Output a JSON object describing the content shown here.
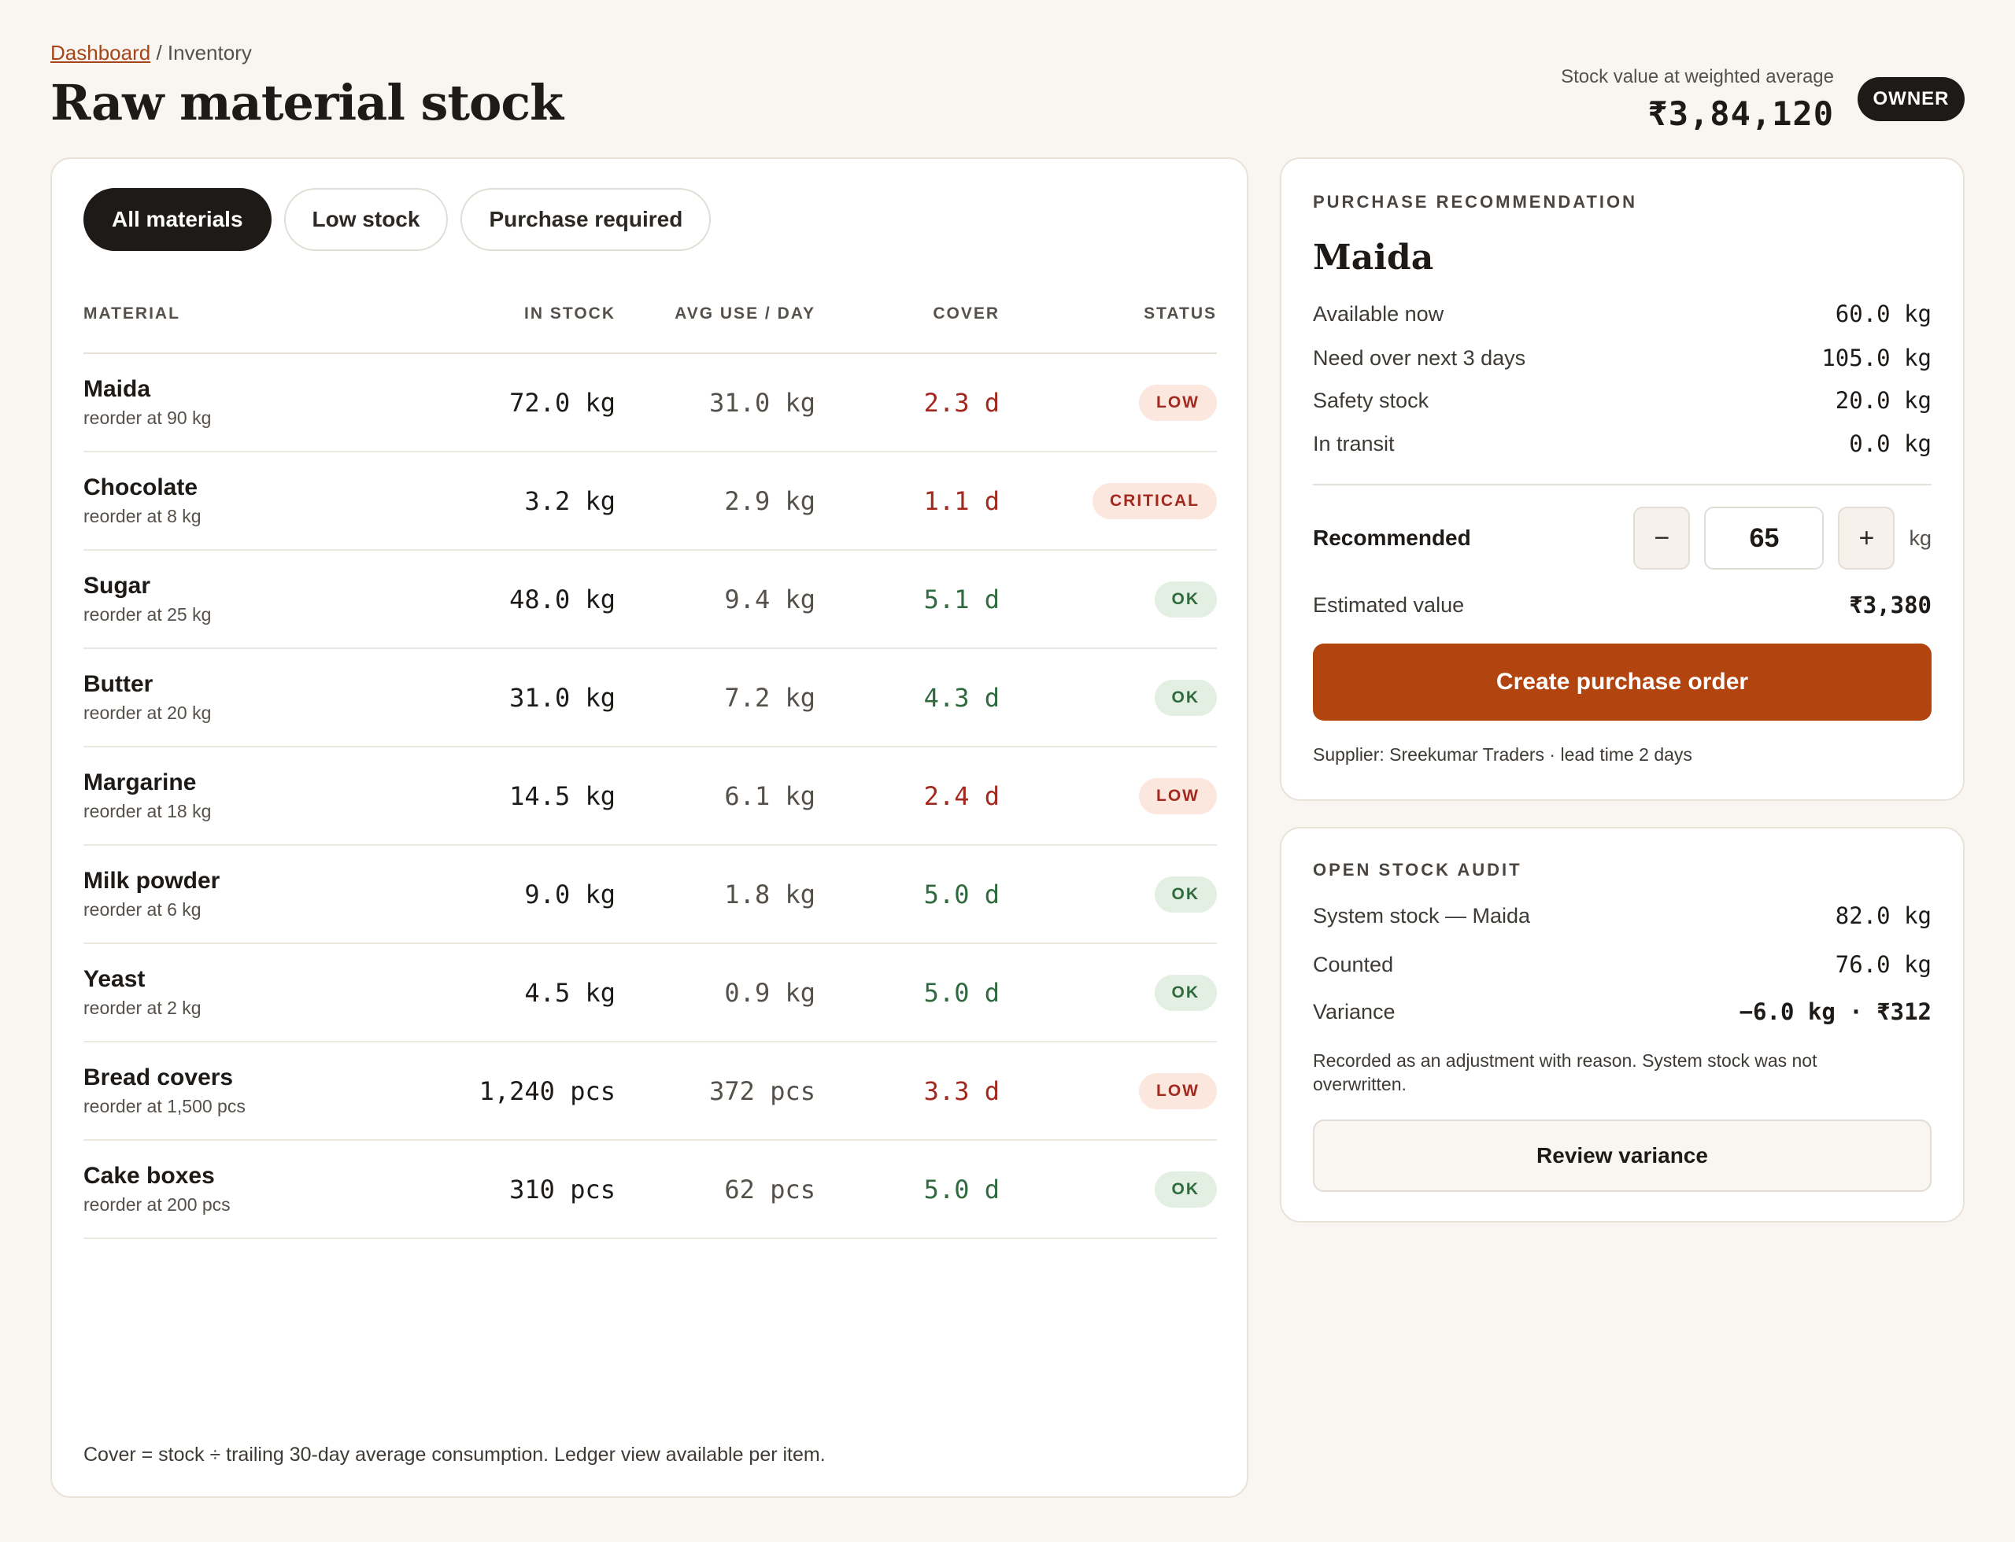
{
  "breadcrumb": {
    "parent": "Dashboard",
    "separator": "/",
    "current": "Inventory"
  },
  "page": {
    "title": "Raw material stock"
  },
  "stock_value": {
    "label": "Stock value at weighted average",
    "amount": "₹3,84,120"
  },
  "role_badge": "OWNER",
  "tabs": [
    {
      "label": "All materials",
      "active": true
    },
    {
      "label": "Low stock",
      "active": false
    },
    {
      "label": "Purchase required",
      "active": false
    }
  ],
  "table": {
    "headers": {
      "material": "MATERIAL",
      "in_stock": "IN STOCK",
      "avg_use": "AVG USE / DAY",
      "cover": "COVER",
      "status": "STATUS"
    },
    "rows": [
      {
        "name": "Maida",
        "reorder": "reorder at 90 kg",
        "in_stock": "72.0 kg",
        "avg_use": "31.0 kg",
        "cover": "2.3 d",
        "status": "LOW"
      },
      {
        "name": "Chocolate",
        "reorder": "reorder at 8 kg",
        "in_stock": "3.2 kg",
        "avg_use": "2.9 kg",
        "cover": "1.1 d",
        "status": "CRITICAL"
      },
      {
        "name": "Sugar",
        "reorder": "reorder at 25 kg",
        "in_stock": "48.0 kg",
        "avg_use": "9.4 kg",
        "cover": "5.1 d",
        "status": "OK"
      },
      {
        "name": "Butter",
        "reorder": "reorder at 20 kg",
        "in_stock": "31.0 kg",
        "avg_use": "7.2 kg",
        "cover": "4.3 d",
        "status": "OK"
      },
      {
        "name": "Margarine",
        "reorder": "reorder at 18 kg",
        "in_stock": "14.5 kg",
        "avg_use": "6.1 kg",
        "cover": "2.4 d",
        "status": "LOW"
      },
      {
        "name": "Milk powder",
        "reorder": "reorder at 6 kg",
        "in_stock": "9.0 kg",
        "avg_use": "1.8 kg",
        "cover": "5.0 d",
        "status": "OK"
      },
      {
        "name": "Yeast",
        "reorder": "reorder at 2 kg",
        "in_stock": "4.5 kg",
        "avg_use": "0.9 kg",
        "cover": "5.0 d",
        "status": "OK"
      },
      {
        "name": "Bread covers",
        "reorder": "reorder at 1,500 pcs",
        "in_stock": "1,240 pcs",
        "avg_use": "372 pcs",
        "cover": "3.3 d",
        "status": "LOW"
      },
      {
        "name": "Cake boxes",
        "reorder": "reorder at 200 pcs",
        "in_stock": "310 pcs",
        "avg_use": "62 pcs",
        "cover": "5.0 d",
        "status": "OK"
      }
    ],
    "footnote": "Cover = stock ÷ trailing 30-day average consumption. Ledger view available per item."
  },
  "recommendation": {
    "section_label": "PURCHASE RECOMMENDATION",
    "material": "Maida",
    "lines": [
      {
        "label": "Available now",
        "value": "60.0 kg"
      },
      {
        "label": "Need over next 3 days",
        "value": "105.0 kg"
      },
      {
        "label": "Safety stock",
        "value": "20.0 kg"
      },
      {
        "label": "In transit",
        "value": "0.0 kg"
      }
    ],
    "recommended_label": "Recommended",
    "decrement": "−",
    "increment": "+",
    "quantity": "65",
    "unit": "kg",
    "estimated_label": "Estimated value",
    "estimated_value": "₹3,380",
    "cta": "Create purchase order",
    "supplier_note": "Supplier: Sreekumar Traders · lead time 2 days"
  },
  "audit": {
    "section_label": "OPEN STOCK AUDIT",
    "lines": [
      {
        "label": "System stock — Maida",
        "value": "82.0 kg"
      },
      {
        "label": "Counted",
        "value": "76.0 kg"
      },
      {
        "label": "Variance",
        "value": "−6.0 kg · ₹312"
      }
    ],
    "note": "Recorded as an adjustment with reason. System stock was not overwritten.",
    "cta": "Review variance"
  },
  "colors": {
    "background": "#f9f6f1",
    "accent": "#b1440f",
    "warn": "#a3281d",
    "ok": "#2f6a3e",
    "dark": "#1d1a17"
  }
}
